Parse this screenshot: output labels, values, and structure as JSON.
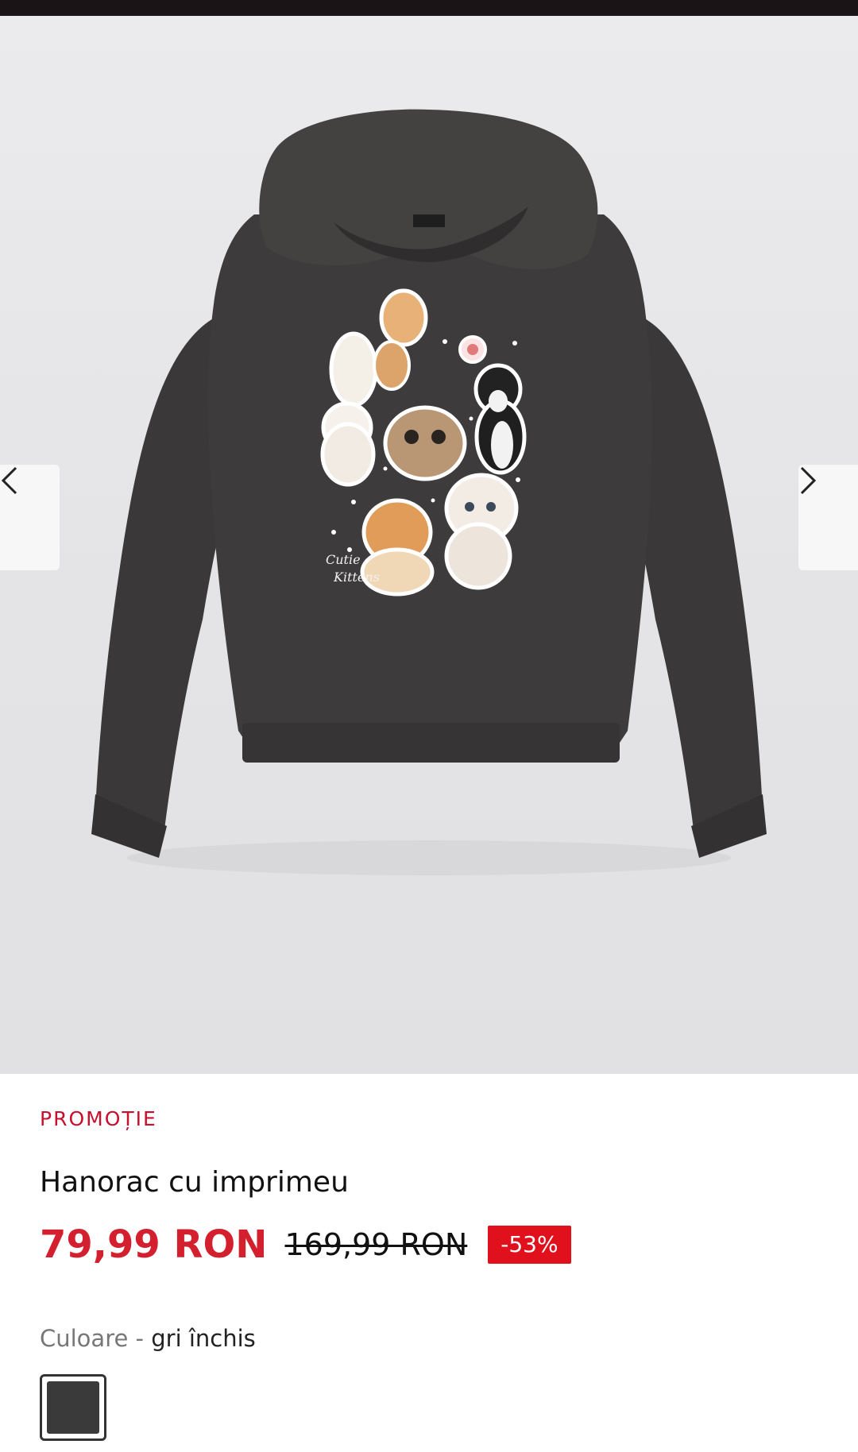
{
  "product": {
    "badge": "PROMOȚIE",
    "title": "Hanorac cu imprimeu",
    "price_current": "79,99 RON",
    "price_original": "169,99 RON",
    "discount": "-53%"
  },
  "print_text": {
    "line1": "Cutie",
    "line2": "Kittens"
  },
  "color": {
    "label": "Culoare",
    "separator": " - ",
    "value": "gri închis",
    "swatch_hex": "#3a3a3a"
  },
  "gallery": {
    "prev_icon": "chevron-left-icon",
    "next_icon": "chevron-right-icon"
  },
  "colors": {
    "promo_red": "#c8102e",
    "price_red": "#d41f2e",
    "badge_red": "#e0101c",
    "hoodie": "#3b3939"
  }
}
